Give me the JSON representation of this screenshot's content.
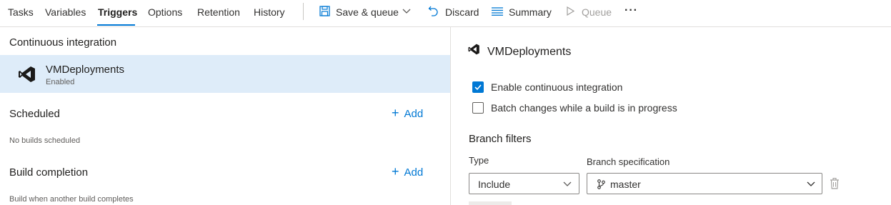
{
  "tabs": [
    {
      "label": "Tasks"
    },
    {
      "label": "Variables"
    },
    {
      "label": "Triggers"
    },
    {
      "label": "Options"
    },
    {
      "label": "Retention"
    },
    {
      "label": "History"
    }
  ],
  "toolbar": {
    "save_queue_label": "Save & queue",
    "discard_label": "Discard",
    "summary_label": "Summary",
    "queue_label": "Queue",
    "more_label": "···"
  },
  "left_panel": {
    "ci_title": "Continuous integration",
    "ci_item": {
      "name": "VMDeployments",
      "status": "Enabled"
    },
    "scheduled_title": "Scheduled",
    "scheduled_add": "Add",
    "scheduled_empty": "No builds scheduled",
    "completion_title": "Build completion",
    "completion_add": "Add",
    "completion_desc": "Build when another build completes"
  },
  "right_panel": {
    "repo_name": "VMDeployments",
    "enable_ci_label": "Enable continuous integration",
    "enable_ci_checked": true,
    "batch_label": "Batch changes while a build is in progress",
    "batch_checked": false,
    "branch_filters_title": "Branch filters",
    "type_label": "Type",
    "type_value": "Include",
    "branch_spec_label": "Branch specification",
    "branch_spec_value": "master"
  },
  "colors": {
    "accent": "#0078d4",
    "selected_row": "#deecf9",
    "vs_logo": "#1b1a19"
  },
  "icons": {
    "save": "save-icon",
    "discard": "undo-icon",
    "summary": "list-icon",
    "queue": "play-icon",
    "repo": "visual-studio-icon",
    "branch": "branch-icon",
    "delete": "trash-icon"
  }
}
